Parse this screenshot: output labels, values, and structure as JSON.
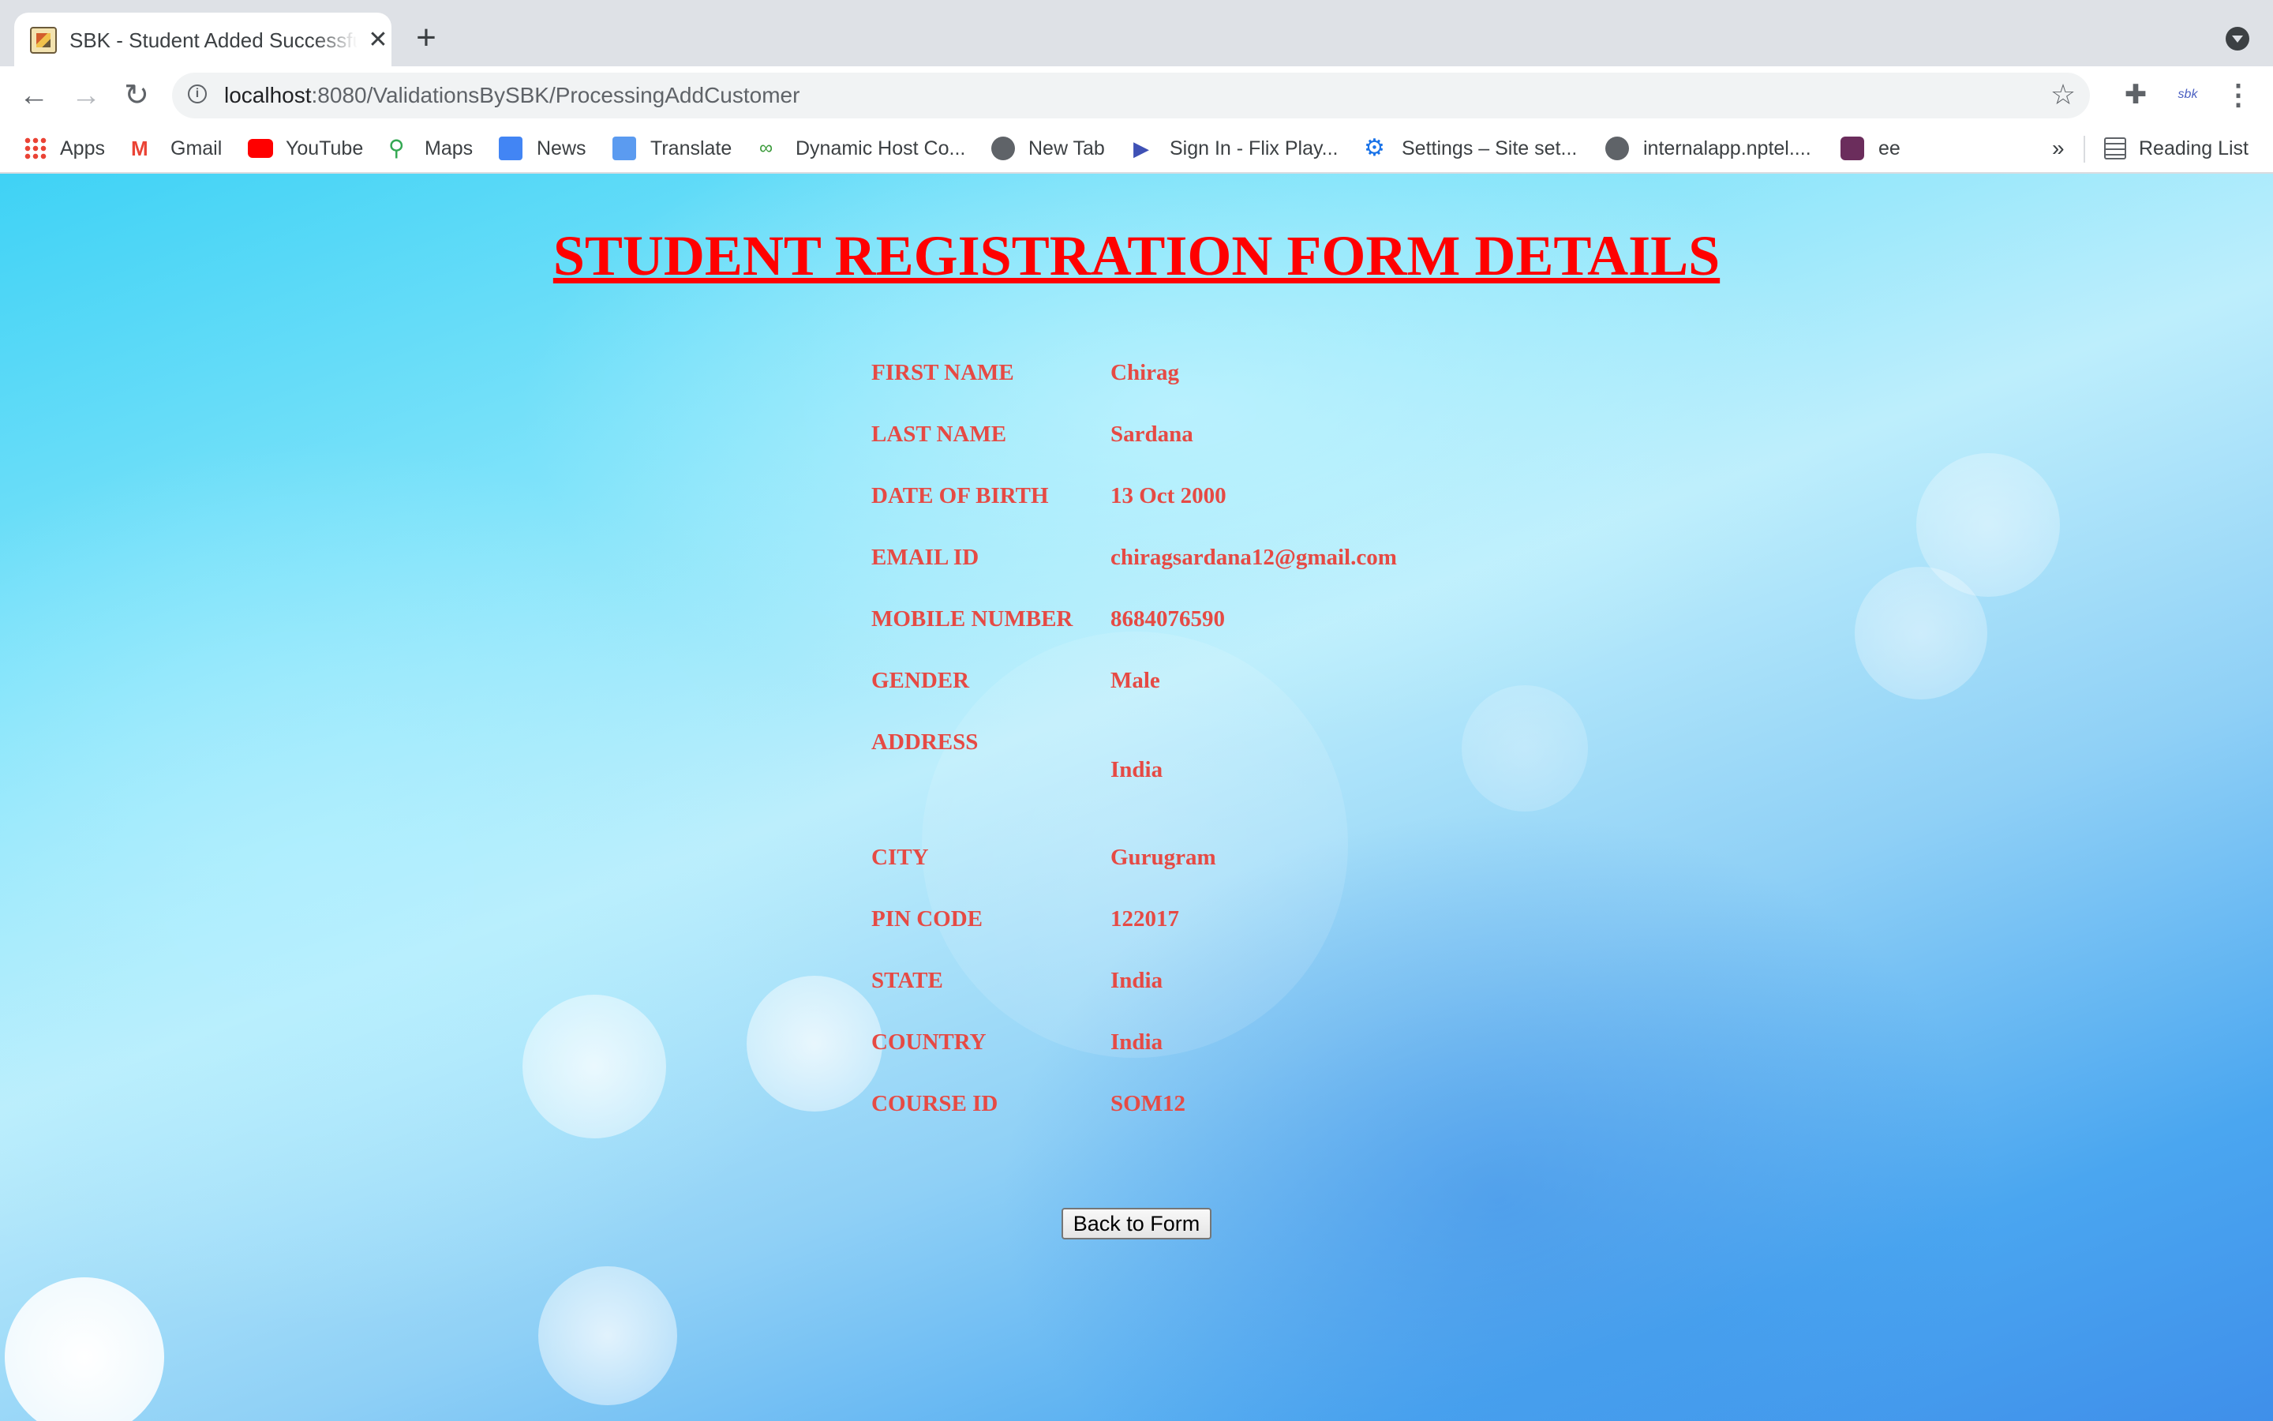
{
  "browser": {
    "tab_title": "SBK - Student Added Successfully",
    "url_host": "localhost",
    "url_path": ":8080/ValidationsBySBK/ProcessingAddCustomer",
    "bookmarks": [
      "Apps",
      "Gmail",
      "YouTube",
      "Maps",
      "News",
      "Translate",
      "Dynamic Host Co...",
      "New Tab",
      "Sign In - Flix Play...",
      "Settings – Site set...",
      "internalapp.nptel....",
      "ee"
    ],
    "more_bookmarks": "»",
    "reading_list": "Reading List"
  },
  "page": {
    "title": "STUDENT REGISTRATION FORM DETAILS",
    "fields": [
      {
        "label": "FIRST NAME",
        "value": "Chirag"
      },
      {
        "label": "LAST NAME",
        "value": "Sardana"
      },
      {
        "label": "DATE OF BIRTH",
        "value": "13 Oct 2000"
      },
      {
        "label": "EMAIL ID",
        "value": "chiragsardana12@gmail.com"
      },
      {
        "label": "MOBILE NUMBER",
        "value": "8684076590"
      },
      {
        "label": "GENDER",
        "value": "Male"
      },
      {
        "label": "ADDRESS",
        "value": "India"
      },
      {
        "label": "CITY",
        "value": "Gurugram"
      },
      {
        "label": "PIN CODE",
        "value": "122017"
      },
      {
        "label": "STATE",
        "value": "India"
      },
      {
        "label": "COUNTRY",
        "value": "India"
      },
      {
        "label": "COURSE ID",
        "value": "SOM12"
      }
    ],
    "back_button": "Back to Form"
  },
  "colors": {
    "title": "#ff0000",
    "field_text": "#e64a44"
  }
}
